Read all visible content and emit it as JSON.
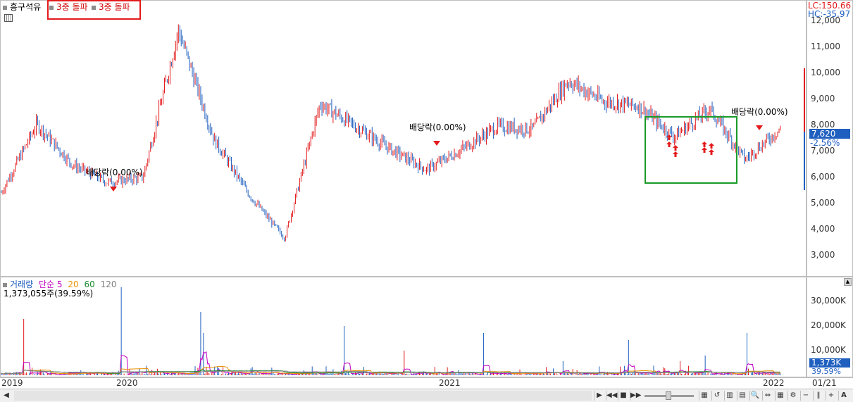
{
  "header": {
    "stock_name": "흥구석유",
    "signal_tag_1": "3중 돌파",
    "signal_tag_2": "3중 돌파",
    "lc_label": "LC:150.66",
    "hc_label": "HC:-35.97"
  },
  "price_axis": {
    "ticks": [
      "12,000",
      "11,000",
      "10,000",
      "9,000",
      "8,000",
      "7,000",
      "6,000",
      "5,000",
      "4,000",
      "3,000"
    ],
    "current_price": "7,620",
    "change_pct": "-2.56%"
  },
  "annotations": {
    "dividend_1": "배당락(0.00%)",
    "dividend_2": "배당락(0.00%)",
    "dividend_3": "배당락(0.00%)"
  },
  "volume_panel": {
    "legend_title": "거래량",
    "legend_ma": "단순",
    "legend_5": "5",
    "legend_20": "20",
    "legend_60": "60",
    "legend_120": "120",
    "current_volume": "1,373,055주(39.59%)",
    "axis_ticks": [
      "30,000K",
      "20,000K",
      "10,000K"
    ],
    "current_value": "1,373K",
    "current_pct": "39.59%"
  },
  "time_axis": {
    "labels": [
      "2019",
      "2020",
      "2021",
      "2022"
    ],
    "right_label": "01/21"
  },
  "colors": {
    "up": "#e31a1c",
    "down": "#1f5fbf",
    "highlight_box": "#1a9b28",
    "signal_box": "#e31a1c",
    "ma5": "#c000c0",
    "ma20": "#e89000",
    "ma60": "#1a8a30",
    "ma120": "#808080"
  },
  "chart_data": {
    "type": "line",
    "title": "",
    "xlabel": "",
    "ylabel": "",
    "x": [
      "2019",
      "2019",
      "2019",
      "2019",
      "2020",
      "2020",
      "2020",
      "2020",
      "2020",
      "2020",
      "2020",
      "2020",
      "2020",
      "2021",
      "2021",
      "2021",
      "2021",
      "2021",
      "2021",
      "2021",
      "2021",
      "2021",
      "2022"
    ],
    "series": [
      {
        "values": [
          5100,
          7800,
          6200,
          5500,
          5700,
          11500,
          7200,
          5000,
          3300,
          8600,
          7700,
          6800,
          6000,
          6800,
          7700,
          7600,
          9500,
          8700,
          8500,
          7300,
          8400,
          6400,
          7620
        ]
      }
    ],
    "ylim": [
      2200,
      12300
    ]
  }
}
